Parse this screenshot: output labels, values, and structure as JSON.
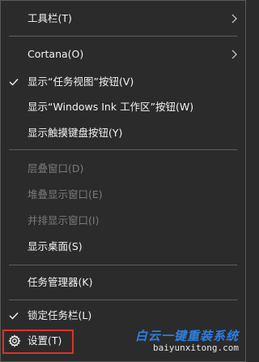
{
  "menu": {
    "items": [
      {
        "label": "工具栏(T)",
        "checked": false,
        "submenu": true,
        "disabled": false
      },
      {
        "label": "Cortana(O)",
        "checked": false,
        "submenu": true,
        "disabled": false
      },
      {
        "label": "显示“任务视图”按钮(V)",
        "checked": true,
        "submenu": false,
        "disabled": false
      },
      {
        "label": "显示“Windows Ink 工作区”按钮(W)",
        "checked": false,
        "submenu": false,
        "disabled": false
      },
      {
        "label": "显示触摸键盘按钮(Y)",
        "checked": false,
        "submenu": false,
        "disabled": false
      },
      {
        "label": "层叠窗口(D)",
        "checked": false,
        "submenu": false,
        "disabled": true
      },
      {
        "label": "堆叠显示窗口(E)",
        "checked": false,
        "submenu": false,
        "disabled": true
      },
      {
        "label": "并排显示窗口(I)",
        "checked": false,
        "submenu": false,
        "disabled": true
      },
      {
        "label": "显示桌面(S)",
        "checked": false,
        "submenu": false,
        "disabled": false
      },
      {
        "label": "任务管理器(K)",
        "checked": false,
        "submenu": false,
        "disabled": false
      },
      {
        "label": "锁定任务栏(L)",
        "checked": true,
        "submenu": false,
        "disabled": false
      },
      {
        "label": "设置(T)",
        "checked": false,
        "submenu": false,
        "disabled": false,
        "icon": "gear-icon"
      }
    ]
  },
  "watermark": {
    "title": "白云一键重装系统",
    "url": "baiyunxitong.com"
  },
  "colors": {
    "menu_bg": "#2b2b2b",
    "text": "#f2f2f2",
    "disabled_text": "#7a7a7a",
    "highlight_border": "#e0302a",
    "watermark_blue": "#2f7fe0"
  }
}
